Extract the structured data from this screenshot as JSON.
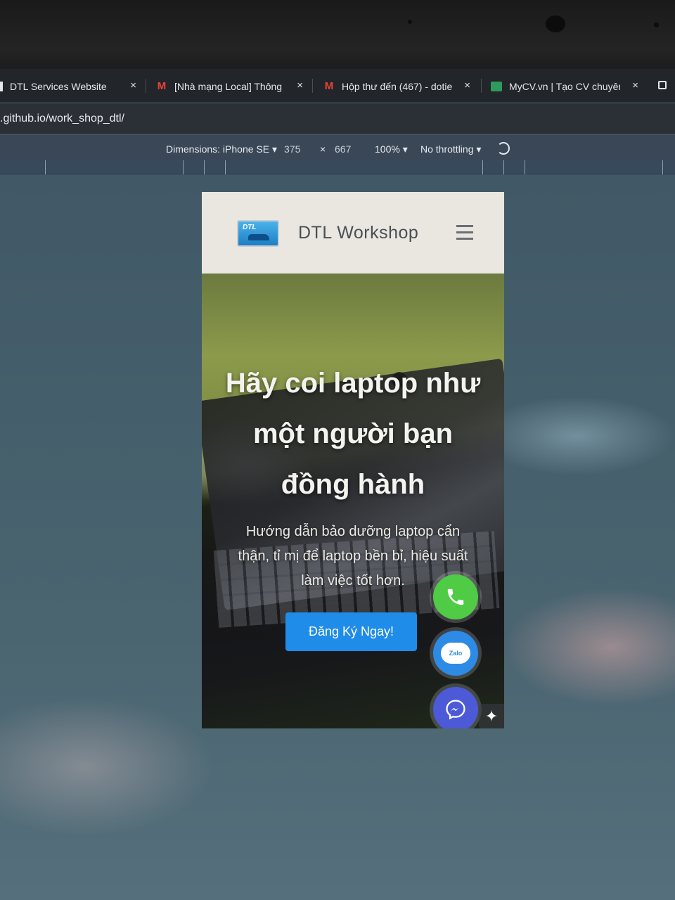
{
  "tabs": [
    {
      "title": "DTL Services Website",
      "icon": "dtl-favicon"
    },
    {
      "title": "[Nhà mạng Local] Thông",
      "icon": "gmail-icon"
    },
    {
      "title": "Hộp thư đến (467) - dotie",
      "icon": "gmail-icon"
    },
    {
      "title": "MyCV.vn | Tạo CV chuyên",
      "icon": "mycv-favicon"
    }
  ],
  "tab_close_glyph": "×",
  "address": {
    "url": ".github.io/work_shop_dtl/"
  },
  "devtools": {
    "dimensions_label": "Dimensions: iPhone SE ▾",
    "width": "375",
    "times": "×",
    "height": "667",
    "zoom": "100% ▾",
    "throttling": "No throttling ▾"
  },
  "site": {
    "logo_text": "DTL",
    "brand": "DTL Workshop",
    "menu_icon": "hamburger-icon",
    "hero_title": "Hãy coi laptop như một người bạn đồng hành",
    "hero_subtitle": "Hướng dẫn bảo dưỡng laptop cẩn thận, tỉ mị để laptop bền bỉ, hiệu suất làm việc tốt hơn.",
    "cta_label": "Đăng Ký Ngay!"
  },
  "floating_buttons": [
    {
      "name": "phone",
      "icon": "phone-icon",
      "color": "#4fcb45"
    },
    {
      "name": "zalo",
      "icon": "zalo-icon",
      "label": "Zalo",
      "color": "#2d8be6"
    },
    {
      "name": "messenger",
      "icon": "messenger-icon",
      "color": "#4c5ad8"
    },
    {
      "name": "map",
      "icon": "map-icon",
      "color": "#5b4fd1"
    }
  ],
  "sparkle_glyph": "✦"
}
